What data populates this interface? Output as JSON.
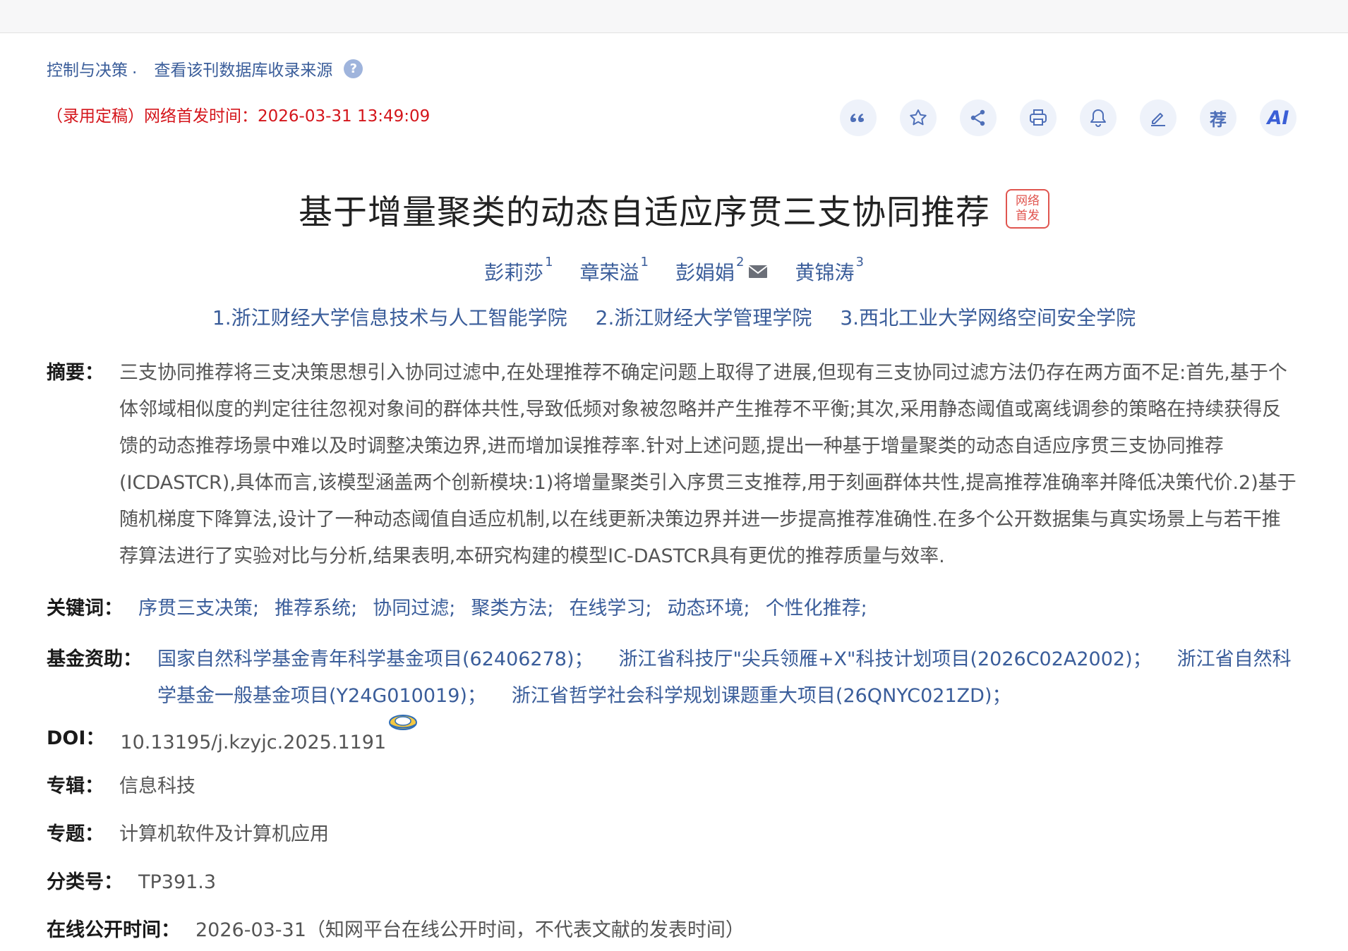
{
  "source": {
    "journal": "控制与决策",
    "dot": ".",
    "db_link": "查看该刊数据库收录来源",
    "help": "?"
  },
  "pubtime": "（录用定稿）网络首发时间：2026-03-31 13:49:09",
  "toolbar": {
    "recommend": "荐",
    "ai": "AI"
  },
  "title": "基于增量聚类的动态自适应序贯三支协同推荐",
  "badge": [
    "网络",
    "首发"
  ],
  "authors": [
    {
      "name": "彭莉莎",
      "sup": "1"
    },
    {
      "name": "章荣溢",
      "sup": "1"
    },
    {
      "name": "彭娟娟",
      "sup": "2"
    },
    {
      "name": "黄锦涛",
      "sup": "3"
    }
  ],
  "orgs": [
    "1.浙江财经大学信息技术与人工智能学院",
    "2.浙江财经大学管理学院",
    "3.西北工业大学网络空间安全学院"
  ],
  "abstract": {
    "label": "摘要：",
    "text": "三支协同推荐将三支决策思想引入协同过滤中,在处理推荐不确定问题上取得了进展,但现有三支协同过滤方法仍存在两方面不足:首先,基于个体邻域相似度的判定往往忽视对象间的群体共性,导致低频对象被忽略并产生推荐不平衡;其次,采用静态阈值或离线调参的策略在持续获得反馈的动态推荐场景中难以及时调整决策边界,进而增加误推荐率.针对上述问题,提出一种基于增量聚类的动态自适应序贯三支协同推荐(ICDASTCR),具体而言,该模型涵盖两个创新模块:1)将增量聚类引入序贯三支推荐,用于刻画群体共性,提高推荐准确率并降低决策代价.2)基于随机梯度下降算法,设计了一种动态阈值自适应机制,以在线更新决策边界并进一步提高推荐准确性.在多个公开数据集与真实场景上与若干推荐算法进行了实验对比与分析,结果表明,本研究构建的模型IC-DASTCR具有更优的推荐质量与效率."
  },
  "keywords": {
    "label": "关键词：",
    "items": [
      "序贯三支决策;",
      "推荐系统;",
      "协同过滤;",
      "聚类方法;",
      "在线学习;",
      "动态环境;",
      "个性化推荐;"
    ]
  },
  "funding": {
    "label": "基金资助：",
    "items": [
      "国家自然科学基金青年科学基金项目(62406278)；",
      "浙江省科技厅\"尖兵领雁+X\"科技计划项目(2026C02A2002)；",
      "浙江省自然科学基金一般基金项目(Y24G010019)；",
      "浙江省哲学社会科学规划课题重大项目(26QNYC021ZD)；"
    ]
  },
  "doi": {
    "label": "DOI：",
    "value": "10.13195/j.kzyjc.2025.1191"
  },
  "collection": {
    "label": "专辑：",
    "value": "信息科技"
  },
  "topic": {
    "label": "专题：",
    "value": "计算机软件及计算机应用"
  },
  "classification": {
    "label": "分类号：",
    "value": "TP391.3"
  },
  "online_time": {
    "label": "在线公开时间：",
    "value": "2026-03-31（知网平台在线公开时间，不代表文献的发表时间）"
  },
  "colors": {
    "link": "#3a5d9a",
    "red": "#d4151b",
    "icon": "#4e6fb8"
  }
}
